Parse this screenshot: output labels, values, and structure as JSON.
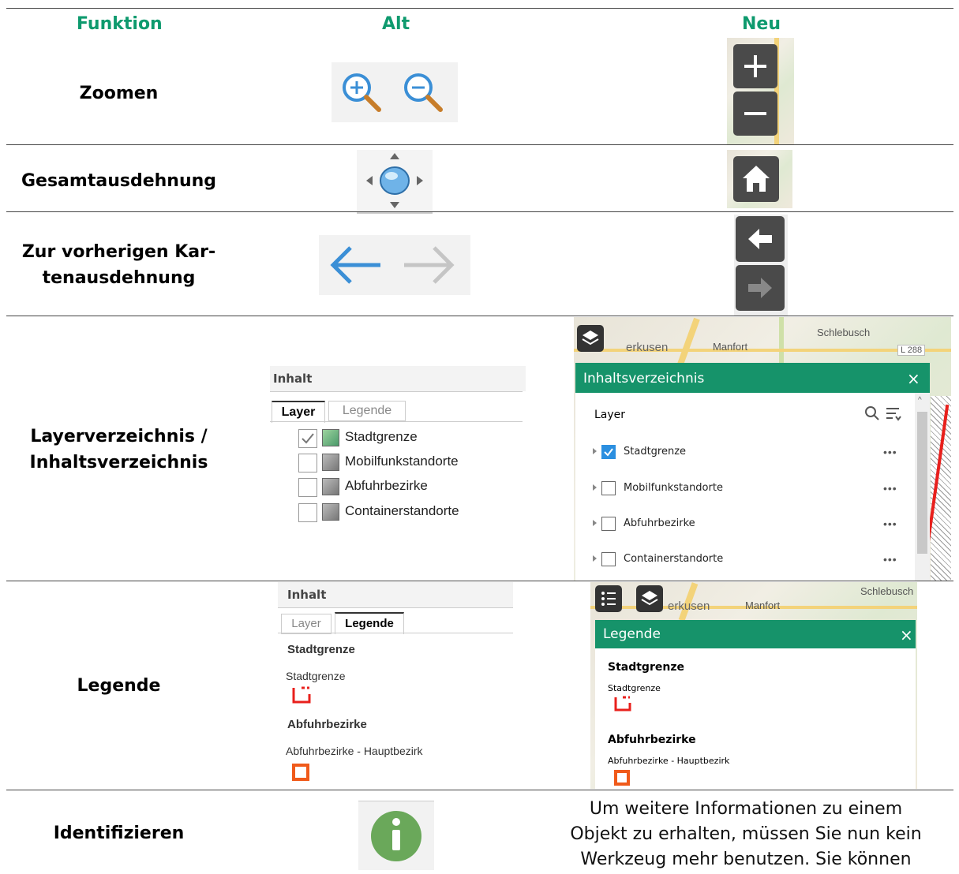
{
  "header": {
    "col_function": "Funktion",
    "col_old": "Alt",
    "col_new": "Neu"
  },
  "rows": {
    "zoom": {
      "label": "Zoomen"
    },
    "extent": {
      "label": "Gesamtausdehnung"
    },
    "previous": {
      "label_line1": "Zur vorherigen Kar-",
      "label_line2": "tenausdehnung"
    },
    "layers": {
      "label_line1": "Layerverzeichnis /",
      "label_line2": "Inhaltsverzeichnis"
    },
    "legend": {
      "label": "Legende"
    },
    "identify": {
      "label": "Identifizieren"
    }
  },
  "old_layer_panel": {
    "title": "Inhalt",
    "tab_layer": "Layer",
    "tab_legend": "Legende",
    "items": [
      "Stadtgrenze",
      "Mobilfunkstandorte",
      "Abfuhrbezirke",
      "Containerstandorte"
    ]
  },
  "new_layer_panel": {
    "title": "Inhaltsverzeichnis",
    "close": "×",
    "section": "Layer",
    "items": [
      "Stadtgrenze",
      "Mobilfunkstandorte",
      "Abfuhrbezirke",
      "Containerstandorte"
    ],
    "more": "•••",
    "map_labels": {
      "place1": "erkusen",
      "place2": "Manfort",
      "place3": "Schlebusch",
      "road": "L 288"
    }
  },
  "old_legend_panel": {
    "title": "Inhalt",
    "tab_layer": "Layer",
    "tab_legend": "Legende",
    "group1": "Stadtgrenze",
    "item1": "Stadtgrenze",
    "group2": "Abfuhrbezirke",
    "item2": "Abfuhrbezirke - Hauptbezirk"
  },
  "new_legend_panel": {
    "title": "Legende",
    "close": "×",
    "group1": "Stadtgrenze",
    "item1": "Stadtgrenze",
    "group2": "Abfuhrbezirke",
    "item2": "Abfuhrbezirke - Hauptbezirk",
    "map_labels": {
      "place1": "erkusen",
      "place2": "Manfort",
      "place3": "Schlebusch"
    }
  },
  "identify_text": {
    "line1": "Um weitere Informationen zu einem",
    "line2": "Objekt zu erhalten, müssen Sie nun kein",
    "line3": "Werkzeug mehr benutzen. Sie können"
  },
  "colors": {
    "accent_green": "#0e9a6e",
    "panel_green": "#16936a",
    "old_blue": "#3b8fd6",
    "info_green": "#6aa85a",
    "legend_red": "#e8201c",
    "legend_orange": "#f05a1a"
  },
  "icons": {
    "zoom_in": "zoom-in-icon",
    "zoom_out": "zoom-out-icon",
    "home": "home-icon",
    "back": "arrow-left-icon",
    "forward": "arrow-right-icon",
    "layers": "layers-icon",
    "legend": "legend-list-icon",
    "info": "info-icon"
  }
}
